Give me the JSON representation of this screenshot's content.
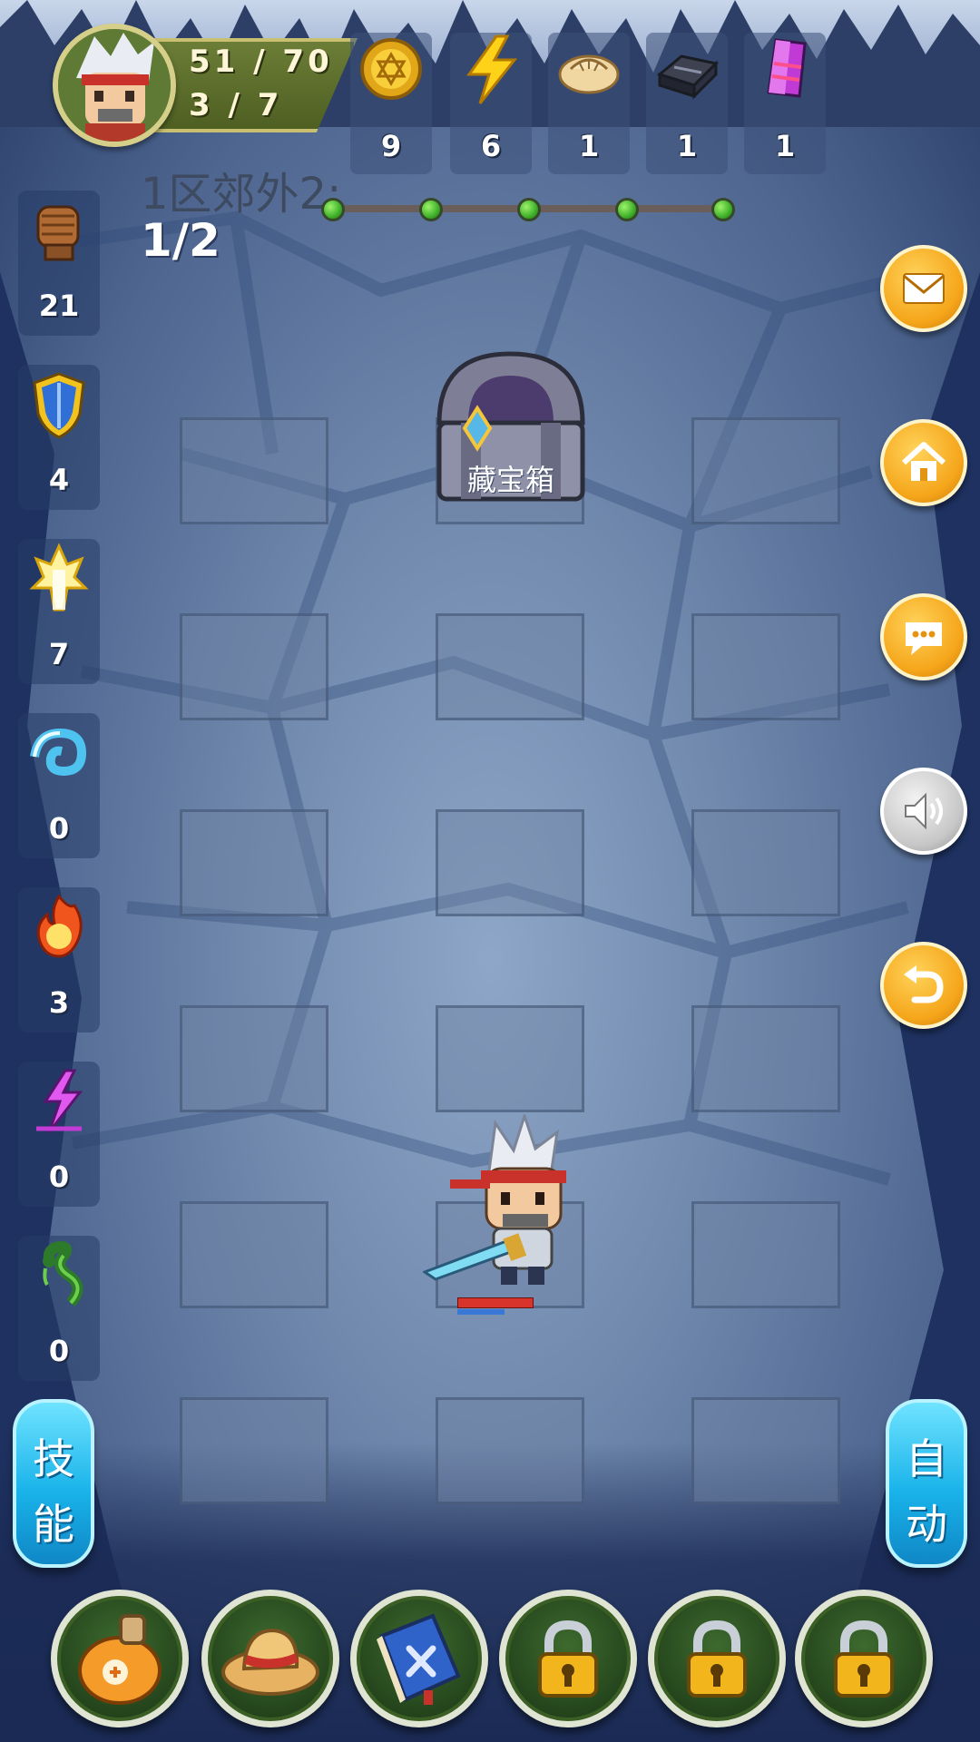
{
  "player": {
    "hp": "51 / 70",
    "level": "3 / 7"
  },
  "resources": [
    {
      "name": "gold-coin-icon",
      "count": "9"
    },
    {
      "name": "lightning-energy-icon",
      "count": "6"
    },
    {
      "name": "dumpling-icon",
      "count": "1"
    },
    {
      "name": "iron-ingot-icon",
      "count": "1"
    },
    {
      "name": "purple-crystal-icon",
      "count": "1"
    }
  ],
  "stage": {
    "title": "1区郊外2:",
    "progress": "1/2",
    "nodes": 5
  },
  "stats": [
    {
      "name": "fist-attack-icon",
      "value": "21"
    },
    {
      "name": "shield-defense-icon",
      "value": "4"
    },
    {
      "name": "holy-light-icon",
      "value": "7"
    },
    {
      "name": "water-wave-icon",
      "value": "0"
    },
    {
      "name": "fire-icon",
      "value": "3"
    },
    {
      "name": "lightning-magic-icon",
      "value": "0"
    },
    {
      "name": "poison-snake-icon",
      "value": "0"
    }
  ],
  "side_buttons": [
    "mail-icon",
    "home-icon",
    "chat-icon",
    "sound-icon",
    "return-icon"
  ],
  "chest": {
    "label": "藏宝箱"
  },
  "skill_button": {
    "line1": "技",
    "line2": "能"
  },
  "auto_button": {
    "line1": "自",
    "line2": "动"
  },
  "bottom_items": [
    "potion-icon",
    "straw-hat-icon",
    "skill-book-icon",
    "lock-icon",
    "lock-icon",
    "lock-icon"
  ],
  "colors": {
    "accent_orange": "#f5a51a",
    "pill_blue": "#19b3ea",
    "hp_red": "#d9342c",
    "mp_blue": "#3a78d8"
  }
}
